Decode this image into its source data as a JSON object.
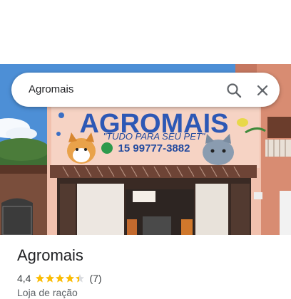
{
  "search": {
    "query": "Agromais"
  },
  "storefront": {
    "sign_name": "AGROMAIS",
    "sign_slogan": "\"TUDO PARA SEU PET\"",
    "sign_phone": "15 99777-3882"
  },
  "place": {
    "name": "Agromais",
    "rating": "4,4",
    "rating_value": 4.4,
    "stars_max": 5,
    "reviews": "(7)",
    "category": "Loja de ração"
  },
  "icons": {
    "search": "search-icon",
    "close": "close-icon",
    "star": "star-icon"
  },
  "colors": {
    "star": "#fbbc04",
    "star_empty": "#dadce0",
    "text_primary": "#202124",
    "text_secondary": "#5f6368"
  }
}
